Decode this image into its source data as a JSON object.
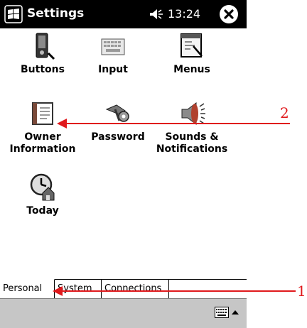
{
  "titlebar": {
    "title": "Settings",
    "time": "13:24",
    "icons": [
      "windows-start-icon",
      "speaker-icon",
      "close-icon"
    ]
  },
  "items": [
    {
      "label": "Buttons",
      "icon": "buttons-icon"
    },
    {
      "label": "Input",
      "icon": "keyboard-icon"
    },
    {
      "label": "Menus",
      "icon": "menus-icon"
    },
    {
      "label": "Owner\nInformation",
      "icon": "owner-information-icon"
    },
    {
      "label": "Password",
      "icon": "password-keys-icon"
    },
    {
      "label": "Sounds &\nNotifications",
      "icon": "sounds-icon"
    },
    {
      "label": "Today",
      "icon": "today-clock-icon"
    }
  ],
  "tabs": [
    {
      "label": "Personal",
      "active": true
    },
    {
      "label": "System",
      "active": false
    },
    {
      "label": "Connections",
      "active": false
    }
  ],
  "callouts": [
    {
      "number": "2",
      "target": "Owner Information"
    },
    {
      "number": "1",
      "target": "Personal"
    }
  ],
  "colors": {
    "callout": "#e0191c",
    "titlebar": "#000000",
    "commandbar": "#c6c6c6"
  }
}
